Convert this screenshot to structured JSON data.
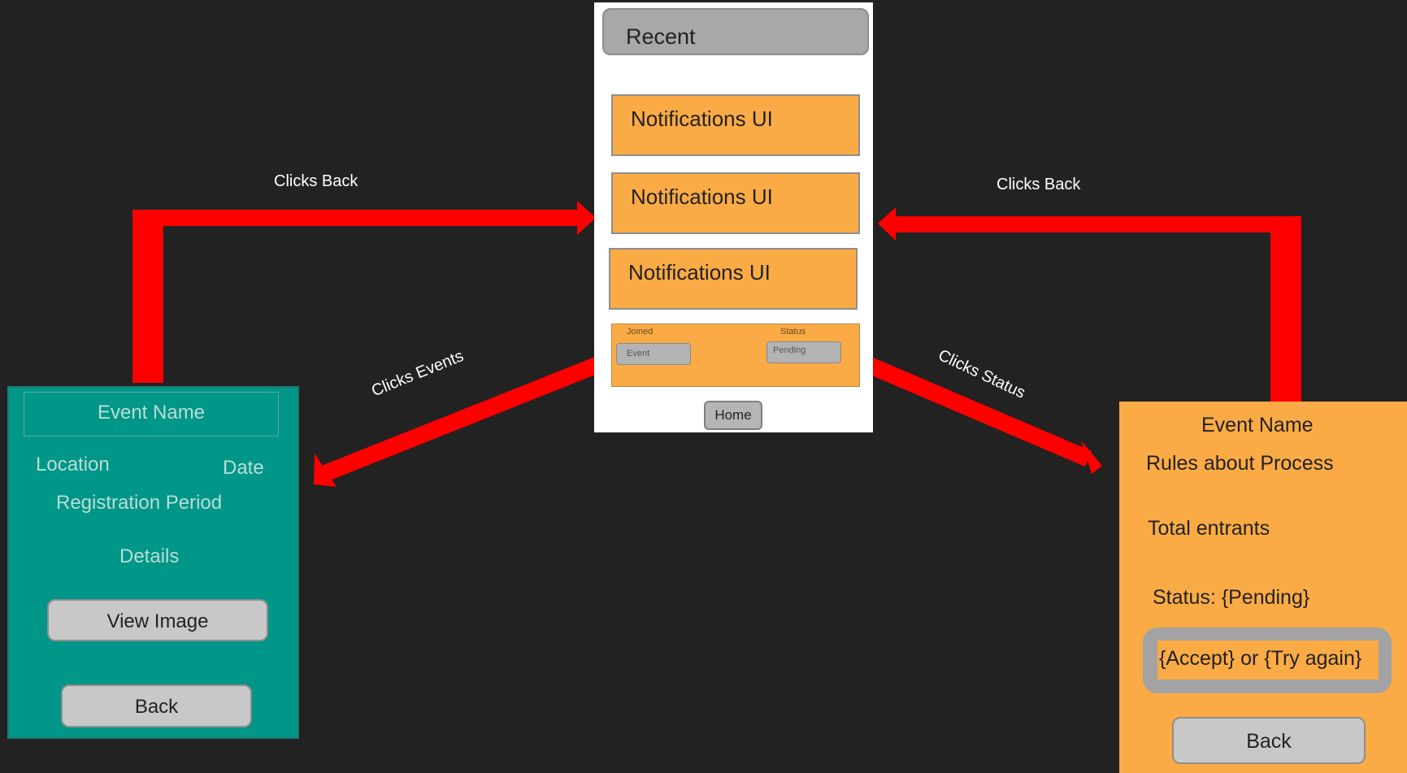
{
  "colors": {
    "background": "#222222",
    "arrow": "#ff0000",
    "orange": "#fbab45",
    "teal": "#009688",
    "grey": "#b5b5b5"
  },
  "center_screen": {
    "recent_label": "Recent",
    "notifications": [
      "Notifications UI",
      "Notifications UI",
      "Notifications UI"
    ],
    "joined_card": {
      "joined_label": "Joined",
      "status_label": "Status",
      "event_box": "Event",
      "pending_box": "Pending"
    },
    "home_button": "Home"
  },
  "left_screen": {
    "event_name": "Event Name",
    "location": "Location",
    "date": "Date",
    "registration_period": "Registration Period",
    "details": "Details",
    "view_image_button": "View Image",
    "back_button": "Back"
  },
  "right_screen": {
    "event_name": "Event Name",
    "rules": "Rules about Process",
    "total_entrants": "Total entrants",
    "status": "Status: {Pending}",
    "choice": "{Accept} or {Try again}",
    "back_button": "Back"
  },
  "arrows": {
    "left_back_label": "Clicks Back",
    "right_back_label": "Clicks Back",
    "events_label": "Clicks Events",
    "status_label": "Clicks Status"
  }
}
